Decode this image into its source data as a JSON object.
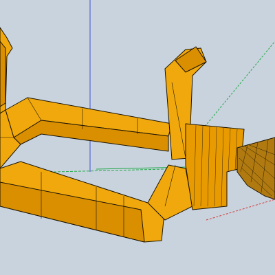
{
  "viewport": {
    "mode": "3d-model-viewer",
    "render_style": "shaded-with-mesh-edges",
    "background_color": "#c9d3dd",
    "model_color": "#f0a80c",
    "model_dark_color": "#d98f00",
    "edge_color": "#1a1200",
    "axis_x_color": "#d23a3a",
    "axis_y_color": "#22a84a",
    "axis_z_color": "#3a4fd0"
  },
  "model": {
    "description_icon": "bracket-frame-model-icon",
    "parts": [
      "rectangular-frame",
      "left-hook",
      "right-hook",
      "cylindrical-hub",
      "textured-handle"
    ]
  }
}
